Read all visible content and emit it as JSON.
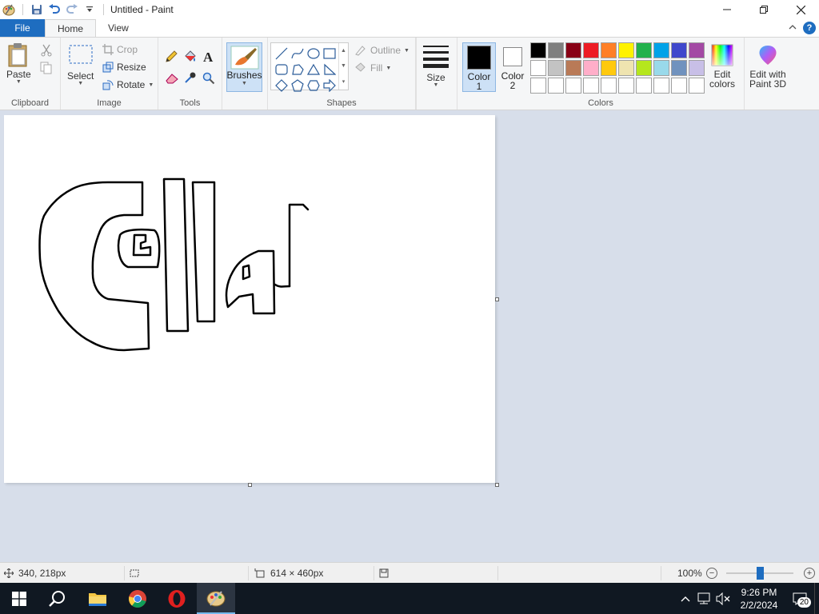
{
  "window": {
    "title": "Untitled - Paint"
  },
  "tabs": {
    "file": "File",
    "home": "Home",
    "view": "View"
  },
  "ribbon": {
    "clipboard": {
      "label": "Clipboard",
      "paste": "Paste"
    },
    "image": {
      "label": "Image",
      "select": "Select",
      "crop": "Crop",
      "resize": "Resize",
      "rotate": "Rotate"
    },
    "tools": {
      "label": "Tools"
    },
    "brushes": "Brushes",
    "shapes": {
      "label": "Shapes",
      "outline": "Outline",
      "fill": "Fill"
    },
    "size": "Size",
    "colors": {
      "label": "Colors",
      "color1": "Color",
      "color1_num": "1",
      "color2": "Color",
      "color2_num": "2",
      "color1_value": "#000000",
      "color2_value": "#ffffff",
      "edit_colors": "Edit",
      "edit_colors_2": "colors",
      "paint3d": "Edit with",
      "paint3d_2": "Paint 3D",
      "palette": [
        "#000000",
        "#7f7f7f",
        "#880015",
        "#ed1c24",
        "#ff7f27",
        "#fff200",
        "#22b14c",
        "#00a2e8",
        "#3f48cc",
        "#a349a4",
        "#ffffff",
        "#c3c3c3",
        "#b97a57",
        "#ffaec9",
        "#ffc90e",
        "#efe4b0",
        "#b5e61d",
        "#99d9ea",
        "#7092be",
        "#c8bfe7",
        "#ffffff",
        "#ffffff",
        "#ffffff",
        "#ffffff",
        "#ffffff",
        "#ffffff",
        "#ffffff",
        "#ffffff",
        "#ffffff",
        "#ffffff"
      ]
    }
  },
  "status": {
    "cursor_pos": "340, 218px",
    "canvas_size": "614 × 460px",
    "zoom": "100%"
  },
  "taskbar": {
    "time": "9:26 PM",
    "date": "2/2/2024",
    "notifications": "20"
  }
}
